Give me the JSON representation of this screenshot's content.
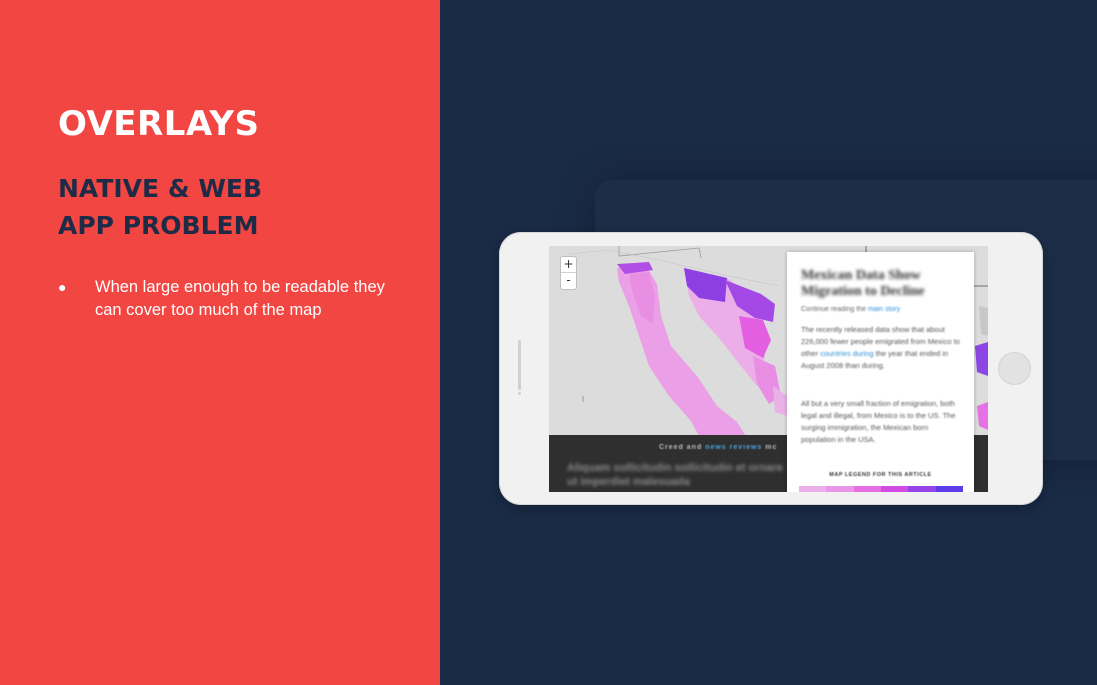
{
  "slide": {
    "title": "OVERLAYS",
    "subtitle_line1": "NATIVE & WEB",
    "subtitle_line2": "APP PROBLEM",
    "bullet_marker": "●",
    "bullet_text": "When large enough to be readable they can cover too much of the map"
  },
  "colors": {
    "left_panel": "#f24643",
    "background": "#1a2b47",
    "subtitle": "#1e2b47"
  },
  "map": {
    "zoom_in_label": "+",
    "zoom_out_label": "-",
    "credit_prefix": "Creed and",
    "credit_link": "news reviews",
    "credit_suffix": "mc",
    "article_heading": "Aliquam sollicitudin sollicitudin et ornare ut imperdiet malesuada"
  },
  "overlay": {
    "title": "Mexican Data Show Migration to Decline",
    "byline_prefix": "Continue reading the",
    "byline_link": "main story",
    "paragraph1_a": "The recently released data show that about 226,000 fewer people emigrated from Mexico to other",
    "paragraph1_link": "countries during",
    "paragraph1_b": "the year that ended in August 2008 than during.",
    "paragraph2": "All but a very small fraction of emigration, both legal and illegal, from Mexico is to the US. The surging immigration, the Mexican born population in the USA.",
    "legend_title": "MAP LEGEND FOR THIS ARTICLE",
    "legend_colors": [
      "#ebb0ea",
      "#e995e8",
      "#e66fe4",
      "#d24be3",
      "#9645e8",
      "#5c3de8"
    ]
  }
}
